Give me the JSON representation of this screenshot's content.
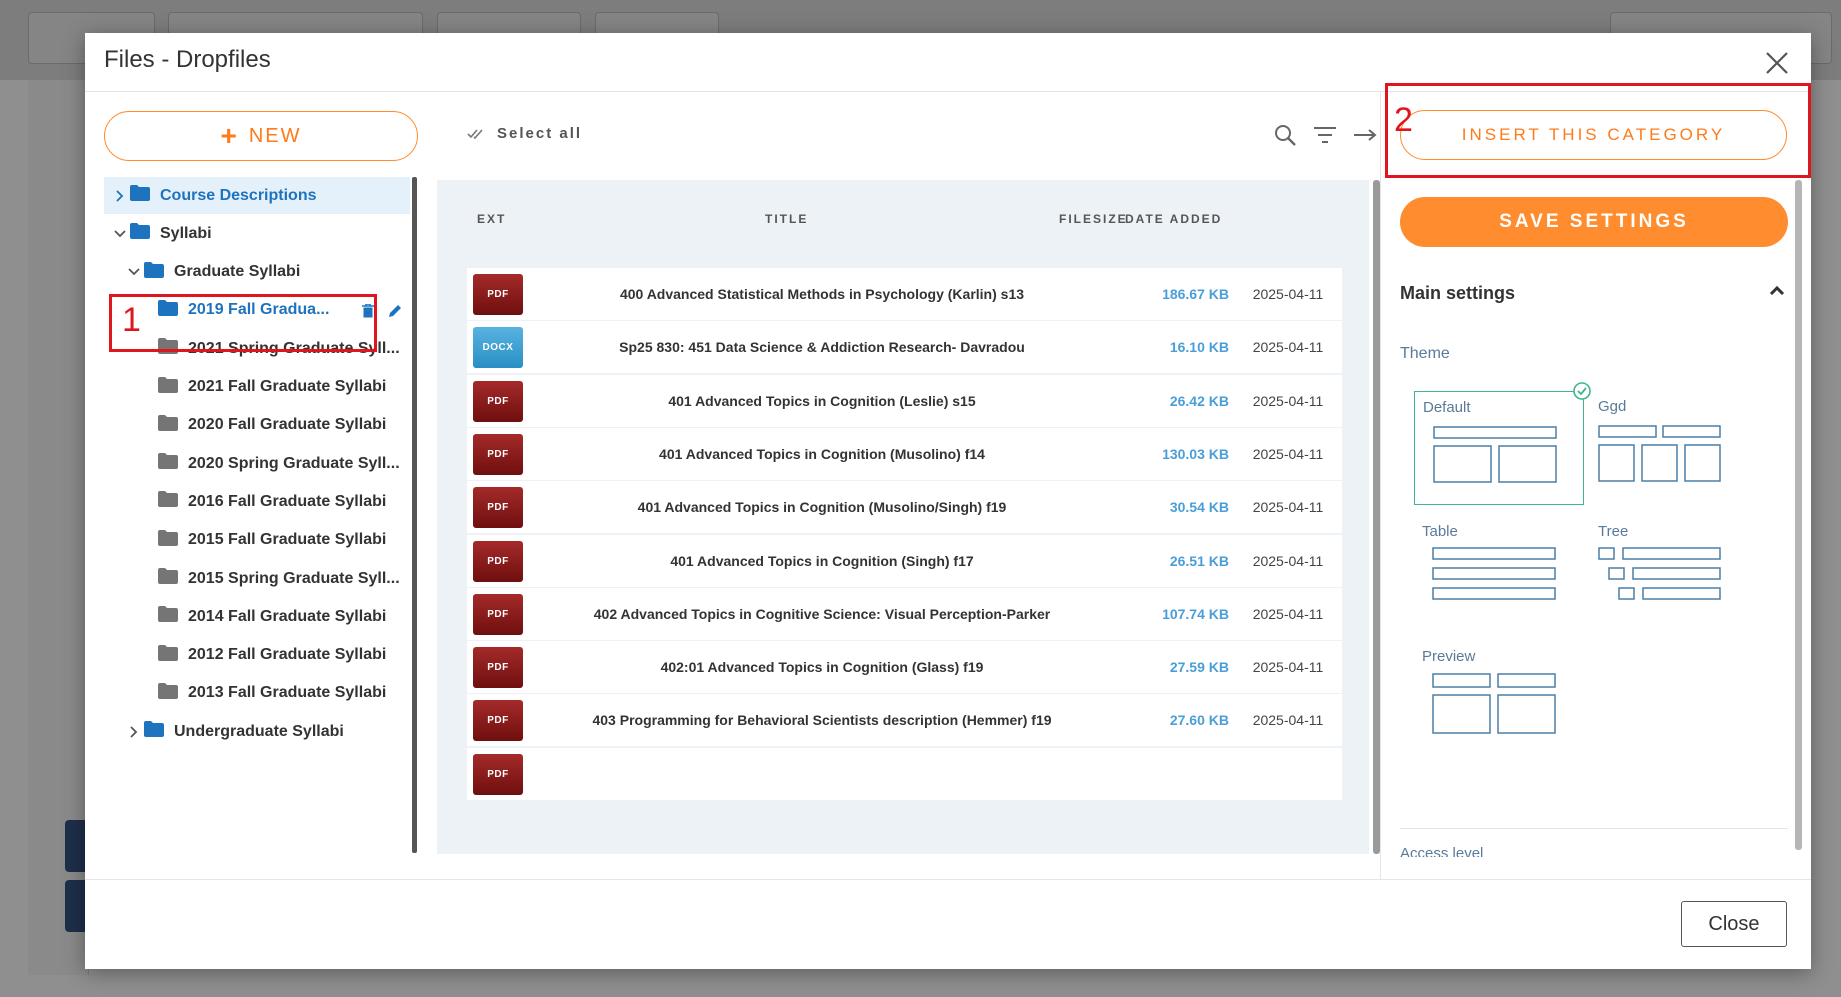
{
  "dialog": {
    "title": "Files - Dropfiles",
    "close_label": "Close"
  },
  "tree": {
    "new_label": "NEW",
    "items": [
      {
        "label": "Course Descriptions",
        "level": 0,
        "chevron": "right",
        "state": "selected"
      },
      {
        "label": "Syllabi",
        "level": 0,
        "chevron": "down",
        "state": "normal"
      },
      {
        "label": "Graduate Syllabi",
        "level": 1,
        "chevron": "down",
        "state": "normal"
      },
      {
        "label": "2019 Fall Gradua...",
        "level": 2,
        "chevron": "none",
        "state": "active"
      },
      {
        "label": "2021 Spring Graduate Syll...",
        "level": 2,
        "chevron": "none",
        "state": "normal"
      },
      {
        "label": "2021 Fall Graduate Syllabi",
        "level": 2,
        "chevron": "none",
        "state": "normal"
      },
      {
        "label": "2020 Fall Graduate Syllabi",
        "level": 2,
        "chevron": "none",
        "state": "normal"
      },
      {
        "label": "2020 Spring Graduate Syll...",
        "level": 2,
        "chevron": "none",
        "state": "normal"
      },
      {
        "label": "2016 Fall Graduate Syllabi",
        "level": 2,
        "chevron": "none",
        "state": "normal"
      },
      {
        "label": "2015 Fall Graduate Syllabi",
        "level": 2,
        "chevron": "none",
        "state": "normal"
      },
      {
        "label": "2015 Spring Graduate Syll...",
        "level": 2,
        "chevron": "none",
        "state": "normal"
      },
      {
        "label": "2014 Fall Graduate Syllabi",
        "level": 2,
        "chevron": "none",
        "state": "normal"
      },
      {
        "label": "2012 Fall Graduate Syllabi",
        "level": 2,
        "chevron": "none",
        "state": "normal"
      },
      {
        "label": "2013 Fall Graduate Syllabi",
        "level": 2,
        "chevron": "none",
        "state": "normal"
      },
      {
        "label": "Undergraduate Syllabi",
        "level": 1,
        "chevron": "right",
        "state": "normal"
      }
    ]
  },
  "files": {
    "select_all_label": "Select all",
    "headers": {
      "ext": "EXT",
      "title": "TITLE",
      "filesize": "FILESIZE",
      "date": "DATE ADDED"
    },
    "rows": [
      {
        "ext": "PDF",
        "title": "400 Advanced Statistical Methods in Psychology (Karlin) s13",
        "size": "186.67 KB",
        "date": "2025-04-11"
      },
      {
        "ext": "DOCX",
        "title": "Sp25 830: 451 Data Science & Addiction Research- Davradou",
        "size": "16.10 KB",
        "date": "2025-04-11"
      },
      {
        "ext": "PDF",
        "title": "401 Advanced Topics in Cognition (Leslie) s15",
        "size": "26.42 KB",
        "date": "2025-04-11"
      },
      {
        "ext": "PDF",
        "title": "401 Advanced Topics in Cognition (Musolino) f14",
        "size": "130.03 KB",
        "date": "2025-04-11"
      },
      {
        "ext": "PDF",
        "title": "401 Advanced Topics in Cognition (Musolino/Singh) f19",
        "size": "30.54 KB",
        "date": "2025-04-11"
      },
      {
        "ext": "PDF",
        "title": "401 Advanced Topics in Cognition (Singh) f17",
        "size": "26.51 KB",
        "date": "2025-04-11"
      },
      {
        "ext": "PDF",
        "title": "402 Advanced Topics in Cognitive Science: Visual Perception-Parker",
        "size": "107.74 KB",
        "date": "2025-04-11"
      },
      {
        "ext": "PDF",
        "title": "402:01 Advanced Topics in Cognition (Glass) f19",
        "size": "27.59 KB",
        "date": "2025-04-11"
      },
      {
        "ext": "PDF",
        "title": "403 Programming for Behavioral Scientists description (Hemmer) f19",
        "size": "27.60 KB",
        "date": "2025-04-11"
      },
      {
        "ext": "PDF",
        "title": "",
        "size": "",
        "date": ""
      }
    ]
  },
  "settings": {
    "insert_label": "INSERT THIS CATEGORY",
    "save_label": "SAVE SETTINGS",
    "main_settings_label": "Main settings",
    "theme_label": "Theme",
    "themes": [
      "Default",
      "Ggd",
      "Table",
      "Tree",
      "Preview"
    ],
    "selected_theme": "Default",
    "access_level_label": "Access level"
  },
  "annotations": [
    "1",
    "2"
  ],
  "colors": {
    "accent_orange": "#ff8c2f",
    "link_blue": "#1e73be",
    "annotation_red": "#e0161e",
    "pdf_red": "#8b1a1a",
    "docx_blue": "#3fa3d6",
    "theme_green": "#3fb68a"
  }
}
